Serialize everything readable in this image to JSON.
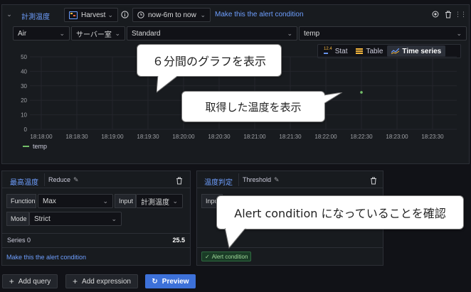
{
  "query_header": {
    "query_name": "計測温度",
    "datasource": "Harvest",
    "time_range": "now-6m to now",
    "alert_link": "Make this the alert condition"
  },
  "filters": {
    "filter1": "Air",
    "filter2": "サーバー室",
    "filter3": "Standard",
    "filter4": "temp"
  },
  "view_toggle": {
    "stat": "Stat",
    "table": "Table",
    "time_series": "Time series",
    "active": "time_series"
  },
  "chart_data": {
    "type": "line",
    "x": [
      "18:18:00",
      "18:18:30",
      "18:19:00",
      "18:19:30",
      "18:20:00",
      "18:20:30",
      "18:21:00",
      "18:21:30",
      "18:22:00",
      "18:22:30",
      "18:23:00",
      "18:23:30"
    ],
    "y_ticks": [
      "0",
      "10",
      "20",
      "30",
      "40",
      "50"
    ],
    "ylim": [
      0,
      50
    ],
    "series": [
      {
        "name": "temp",
        "color": "#73bf69",
        "points": [
          {
            "x": "18:22:30",
            "y": 25.5
          }
        ]
      }
    ],
    "legend": "bottom-left"
  },
  "callouts": {
    "graph": "６分間のグラフを表示",
    "temp": "取得した温度を表示",
    "alert": "Alert condition になっていることを確認"
  },
  "reduce_expr": {
    "name": "最高温度",
    "type": "Reduce",
    "function_label": "Function",
    "function_value": "Max",
    "input_label": "Input",
    "input_value": "計測温度",
    "mode_label": "Mode",
    "mode_value": "Strict",
    "series_label": "Series 0",
    "series_value": "25.5",
    "alert_link": "Make this the alert condition"
  },
  "threshold_expr": {
    "name": "温度判定",
    "type": "Threshold",
    "input_label": "Input",
    "badge": "Alert condition"
  },
  "bottom_buttons": {
    "add_query": "Add query",
    "add_expression": "Add expression",
    "preview": "Preview"
  },
  "colors": {
    "accent": "#3d71d9",
    "link": "#6e9fff",
    "series": "#73bf69"
  }
}
